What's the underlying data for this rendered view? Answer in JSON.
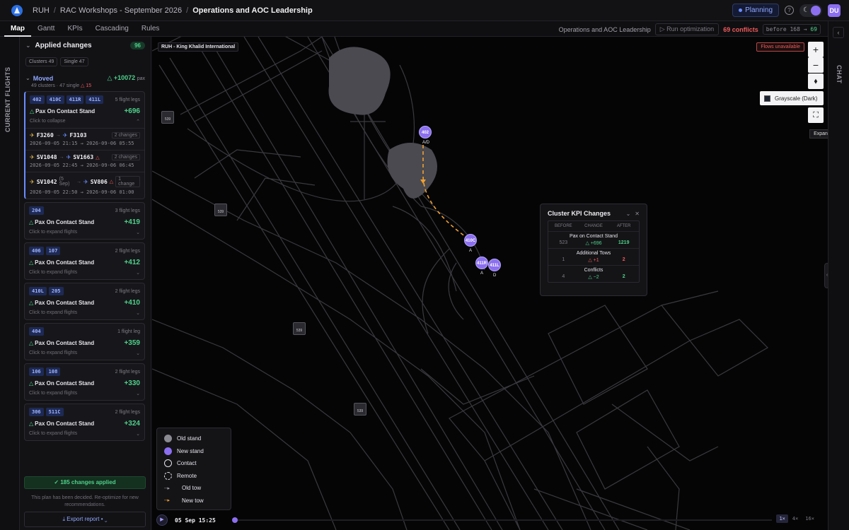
{
  "header": {
    "breadcrumb": [
      "RUH",
      "RAC Workshops - September 2026",
      "Operations and AOC Leadership"
    ],
    "planning_label": "Planning",
    "avatar_initials": "DU"
  },
  "tabs": [
    "Map",
    "Gantt",
    "KPIs",
    "Cascading",
    "Rules"
  ],
  "toolbar": {
    "plan_name": "Operations and AOC Leadership",
    "run_label": "Run optimization",
    "conflicts_label": "69 conflicts",
    "delta_before": "before 168 →",
    "delta_after": "69"
  },
  "left_rail": {
    "label": "CURRENT FLIGHTS"
  },
  "changes_panel": {
    "title": "Applied changes",
    "count": "96",
    "filters": [
      "Clusters 49",
      "Single 47"
    ],
    "moved": {
      "title": "Moved",
      "total": "+10072",
      "total_unit": "pax",
      "sub_text": "49 clusters · 47 single",
      "sub_warn": "15"
    },
    "expanded_card": {
      "stands": [
        "402",
        "410C",
        "411R",
        "411L"
      ],
      "legs": "5 flight legs",
      "kpi_label": "Pax On Contact Stand",
      "kpi_value": "+696",
      "hint": "Click to collapse",
      "flights": [
        {
          "from": "F3260",
          "to": "F3103",
          "changes": "2 changes",
          "time": "2026-09-05 21:15 → 2026-09-06 05:55",
          "from_note": "",
          "warn": false
        },
        {
          "from": "SV1048",
          "to": "SV1663",
          "changes": "2 changes",
          "time": "2026-09-05 22:45 → 2026-09-06 06:45",
          "from_note": "",
          "warn": true
        },
        {
          "from": "SV1042",
          "to": "SV806",
          "changes": "1 change",
          "time": "2026-09-05 22:50 → 2026-09-06 01:00",
          "from_note": "(5 Sep)",
          "warn": true
        }
      ]
    },
    "cards": [
      {
        "stands": [
          "204"
        ],
        "legs": "3 flight legs",
        "kpi_label": "Pax On Contact Stand",
        "kpi_value": "+419",
        "hint": "Click to expand flights"
      },
      {
        "stands": [
          "406",
          "107"
        ],
        "legs": "2 flight legs",
        "kpi_label": "Pax On Contact Stand",
        "kpi_value": "+412",
        "hint": "Click to expand flights"
      },
      {
        "stands": [
          "410L",
          "205"
        ],
        "legs": "2 flight legs",
        "kpi_label": "Pax On Contact Stand",
        "kpi_value": "+410",
        "hint": "Click to expand flights"
      },
      {
        "stands": [
          "404"
        ],
        "legs": "1 flight leg",
        "kpi_label": "Pax On Contact Stand",
        "kpi_value": "+359",
        "hint": "Click to expand flights"
      },
      {
        "stands": [
          "106",
          "108"
        ],
        "legs": "2 flight legs",
        "kpi_label": "Pax On Contact Stand",
        "kpi_value": "+330",
        "hint": "Click to expand flights"
      },
      {
        "stands": [
          "306",
          "511C"
        ],
        "legs": "2 flight legs",
        "kpi_label": "Pax On Contact Stand",
        "kpi_value": "+324",
        "hint": "Click to expand flights"
      }
    ],
    "applied_text": "✓ 185 changes applied",
    "decided_note": "This plan has been decided. Re-optimize for new recommendations.",
    "export_label": "Export report"
  },
  "map": {
    "airport_label": "RUH - King Khalid International",
    "flows_badge": "Flows unavailable",
    "layer_label": "Grayscale (Dark)",
    "tooltip": "Expand chat",
    "gate_label": "539",
    "markers": [
      {
        "label": "402",
        "sub": "A/D"
      },
      {
        "label": "410C",
        "sub": "A"
      },
      {
        "label": "411R",
        "sub": "A"
      },
      {
        "label": "411L",
        "sub": "D"
      }
    ]
  },
  "kpi_panel": {
    "title": "Cluster KPI Changes",
    "columns": [
      "BEFORE",
      "CHANGE",
      "AFTER"
    ],
    "rows": [
      {
        "name": "Pax on Contact Stand",
        "before": "523",
        "change": "△ +696",
        "after": "1219",
        "tone": "good"
      },
      {
        "name": "Additional Tows",
        "before": "1",
        "change": "△ +1",
        "after": "2",
        "tone": "bad"
      },
      {
        "name": "Conflicts",
        "before": "4",
        "change": "△ −2",
        "after": "2",
        "tone": "good"
      }
    ]
  },
  "legend": {
    "items": [
      "Old stand",
      "New stand",
      "Contact",
      "Remote",
      "Old tow",
      "New tow"
    ]
  },
  "timeline": {
    "time": "05 Sep 15:25",
    "speeds": [
      "1×",
      "4×",
      "16×"
    ],
    "active_speed": "1×"
  },
  "right_rail": {
    "label": "CHAT"
  },
  "colors": {
    "accent": "#8b6ff0",
    "positive": "#4fd18b",
    "negative": "#ef5a5a",
    "tow": "#f0a030"
  }
}
